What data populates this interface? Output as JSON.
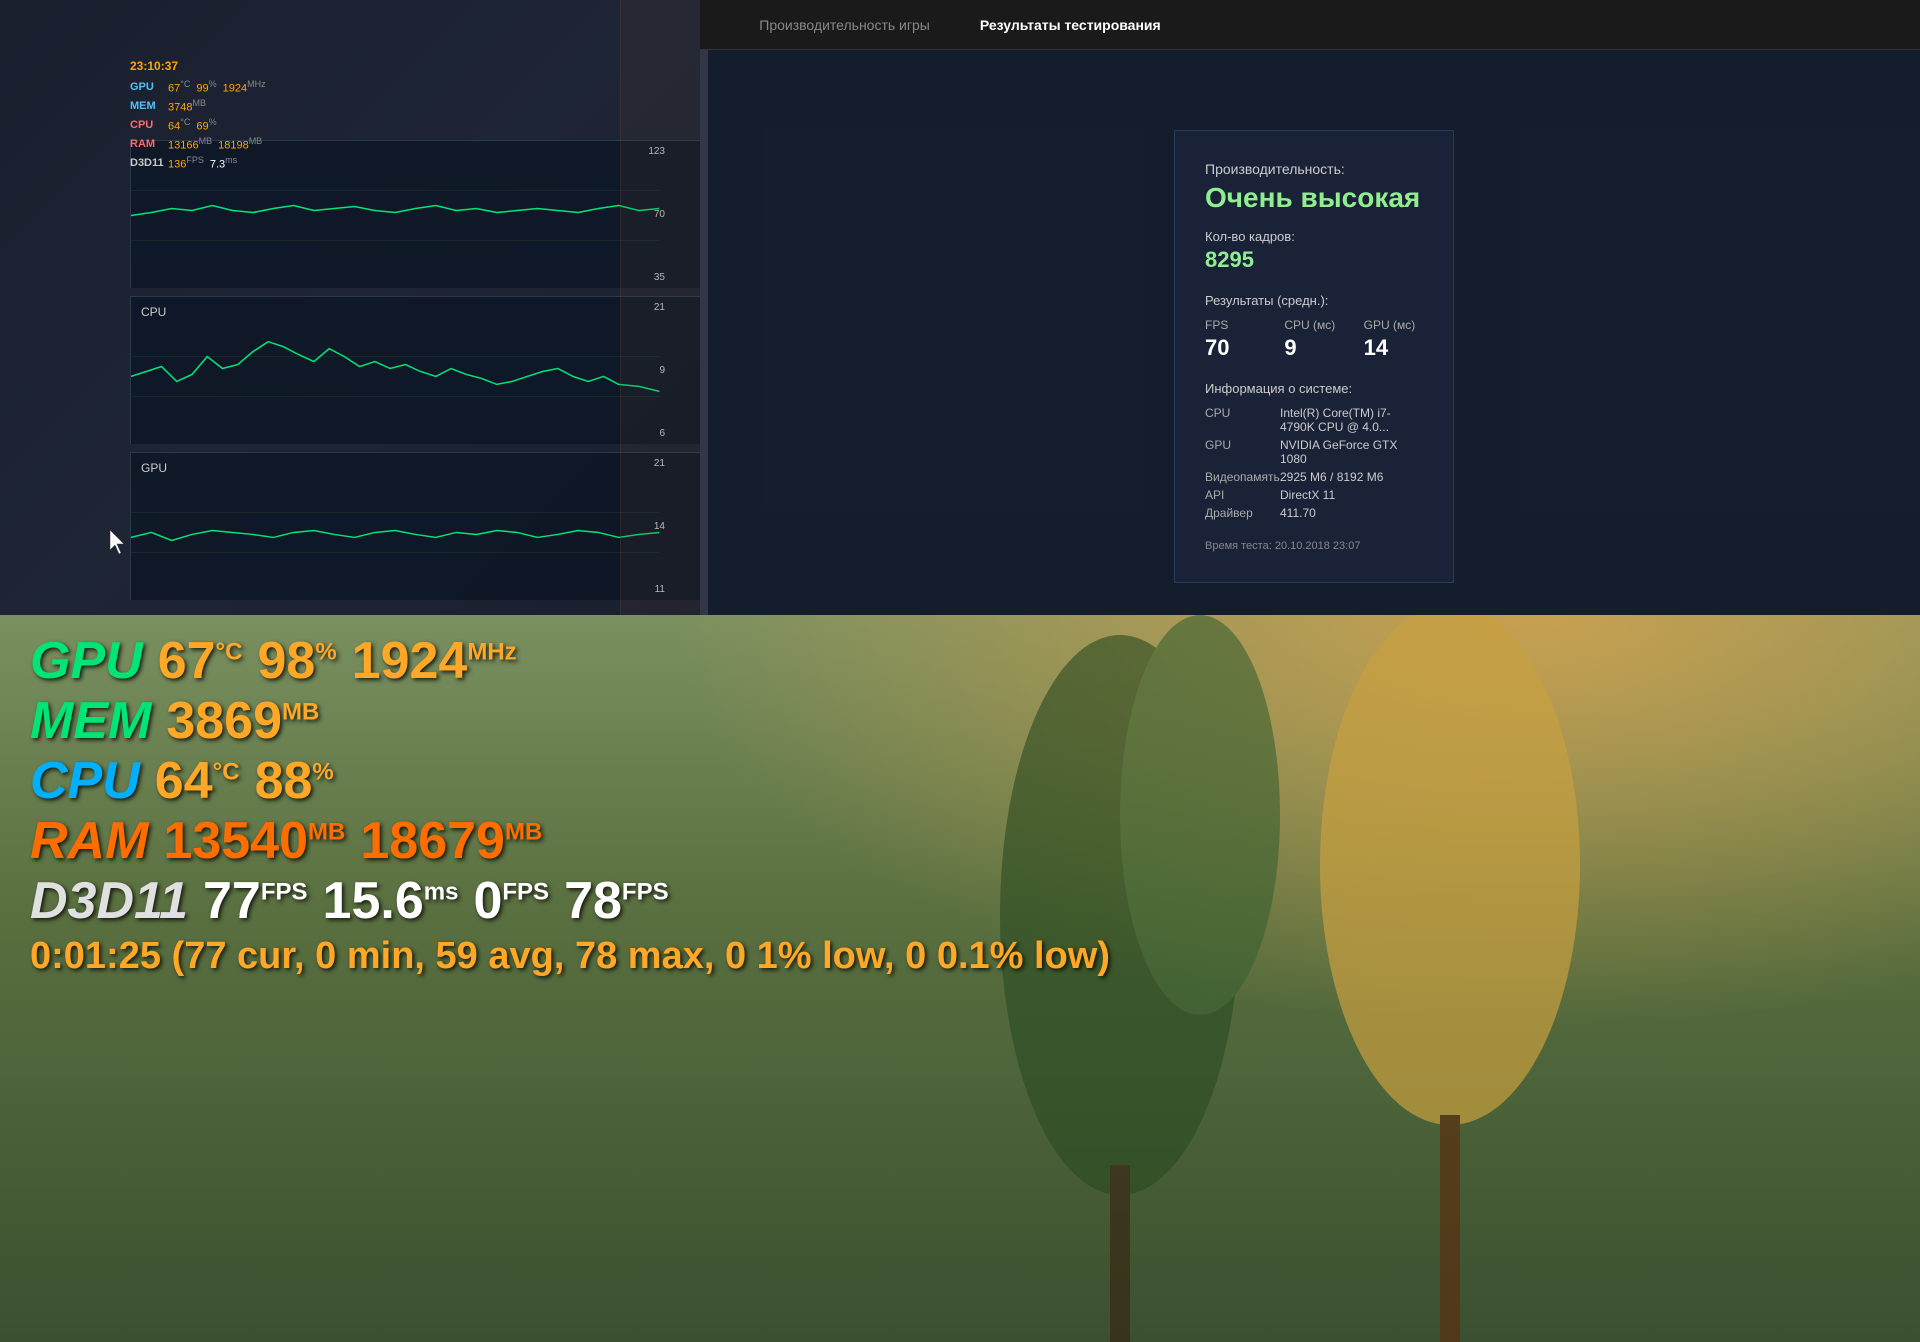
{
  "nav": {
    "tab1": "Производительность игры",
    "tab2": "Результаты тестирования"
  },
  "hud": {
    "time": "23:10:37",
    "gpu_label": "GPU",
    "gpu_temp": "67",
    "gpu_temp_unit": "°C",
    "gpu_load": "99",
    "gpu_load_unit": "%",
    "gpu_clock": "1924",
    "gpu_clock_unit": "MHz",
    "mem_label": "MEM",
    "mem_val": "3748",
    "mem_unit": "MB",
    "cpu_label": "CPU",
    "cpu_temp": "64",
    "cpu_temp_unit": "°C",
    "cpu_load": "69",
    "cpu_load_unit": "%",
    "ram_label": "RAM",
    "ram_val1": "13166",
    "ram_unit1": "MB",
    "ram_val2": "18198",
    "ram_unit2": "MB",
    "d3d_label": "D3D11",
    "d3d_fps": "136",
    "d3d_fps_unit": "FPS",
    "d3d_ms": "7.3",
    "d3d_ms_unit": "ms"
  },
  "graphs": {
    "top_graph": {
      "y_top": "123",
      "y_mid": "70",
      "y_bot": "35"
    },
    "cpu_graph": {
      "label": "CPU",
      "y_top": "21",
      "y_mid": "9",
      "y_bot": "6"
    },
    "gpu_graph": {
      "label": "GPU",
      "y_top": "21",
      "y_mid": "14",
      "y_bot": "11"
    }
  },
  "results": {
    "perf_label": "Производительность:",
    "perf_value": "Очень высокая",
    "frames_label": "Кол-во кадров:",
    "frames_value": "8295",
    "avg_label": "Результаты (средн.):",
    "fps_header": "FPS",
    "fps_value": "70",
    "cpu_header": "CPU (мс)",
    "cpu_value": "9",
    "gpu_header": "GPU (мс)",
    "gpu_value": "14",
    "sys_label": "Информация о системе:",
    "cpu_key": "CPU",
    "cpu_val": "Intel(R) Core(TM) i7-4790K CPU @ 4.0...",
    "gpu_key": "GPU",
    "gpu_val": "NVIDIA GeForce GTX 1080",
    "vram_key": "Видеопамять",
    "vram_val": "2925 М6 / 8192 М6",
    "api_key": "API",
    "api_val": "DirectX 11",
    "driver_key": "Драйвер",
    "driver_val": "411.70",
    "test_time": "Время теста: 20.10.2018 23:07"
  },
  "bottom_hud": {
    "gpu_label": "GPU",
    "gpu_temp": "67",
    "gpu_temp_unit": "°C",
    "gpu_load": "98",
    "gpu_load_unit": "%",
    "gpu_clock": "1924",
    "gpu_clock_unit": "MHz",
    "mem_label": "MEM",
    "mem_val": "3869",
    "mem_unit": "MB",
    "cpu_label": "CPU",
    "cpu_temp": "64",
    "cpu_temp_unit": "°C",
    "cpu_load": "88",
    "cpu_load_unit": "%",
    "ram_label": "RAM",
    "ram_val1": "13540",
    "ram_unit1": "MB",
    "ram_val2": "18679",
    "ram_unit2": "MB",
    "d3d_label": "D3D11",
    "d3d_fps": "77",
    "d3d_fps_unit": "FPS",
    "d3d_ms": "15.6",
    "d3d_ms_unit": "ms",
    "d3d_fps2": "0",
    "d3d_fps2_unit": "FPS",
    "d3d_fps3": "78",
    "d3d_fps3_unit": "FPS",
    "summary": "0:01:25 (77 cur, 0 min, 59 avg, 78 max, 0 1% low, 0 0.1% low)"
  }
}
